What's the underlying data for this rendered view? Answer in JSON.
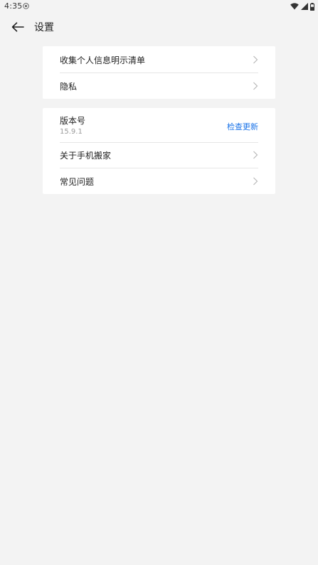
{
  "status_bar": {
    "time": "4:35",
    "icons": [
      "notification-eye-icon",
      "wifi-icon",
      "signal-icon",
      "battery-icon"
    ]
  },
  "header": {
    "back_icon": "arrow-left-icon",
    "title": "设置"
  },
  "groups": [
    {
      "items": [
        {
          "label": "收集个人信息明示清单",
          "icon": "chevron-right-icon"
        },
        {
          "label": "隐私",
          "icon": "chevron-right-icon"
        }
      ]
    },
    {
      "version": {
        "label": "版本号",
        "value": "15.9.1",
        "action": "检查更新"
      },
      "items": [
        {
          "label": "关于手机搬家",
          "icon": "chevron-right-icon"
        },
        {
          "label": "常见问题",
          "icon": "chevron-right-icon"
        }
      ]
    }
  ],
  "colors": {
    "background": "#f3f3f3",
    "card": "#ffffff",
    "accent": "#1a73e8",
    "secondary_text": "#9a9a9a"
  }
}
